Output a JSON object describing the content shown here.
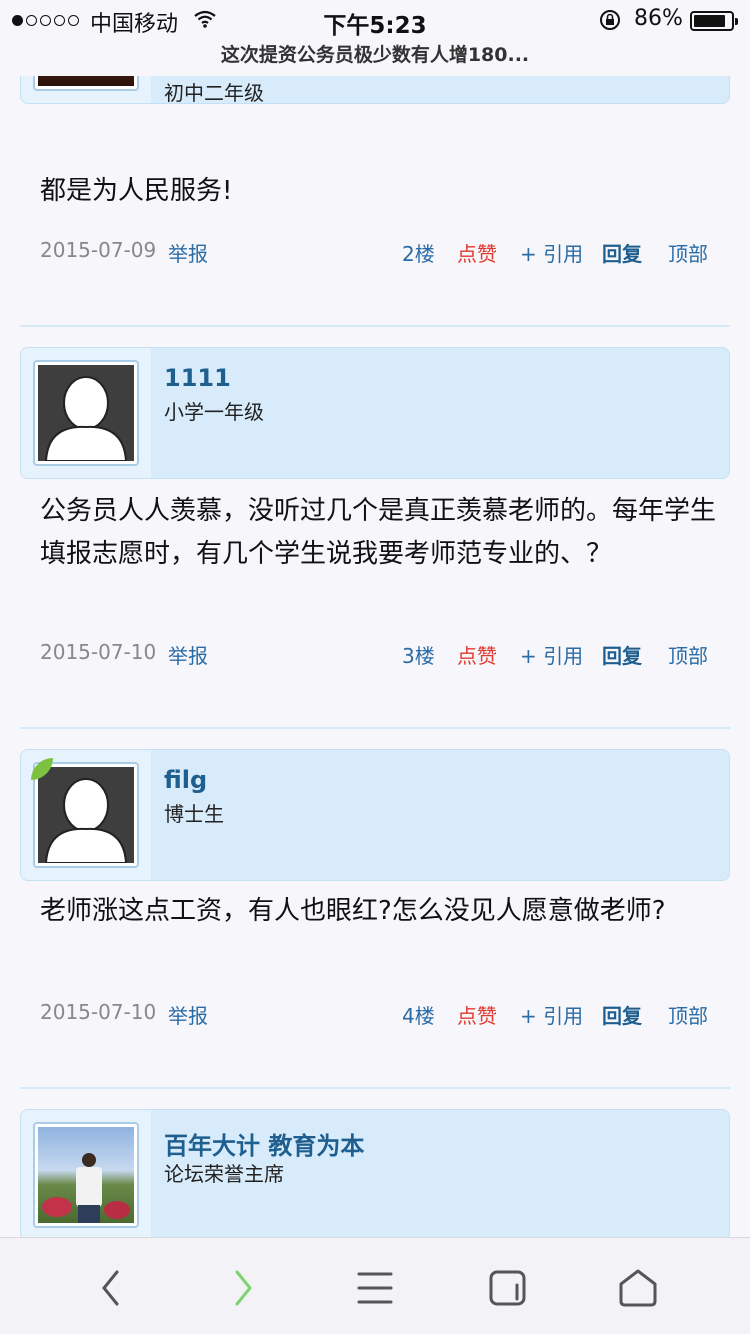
{
  "status_bar": {
    "carrier": "中国移动",
    "time": "下午5:23",
    "battery": "86%",
    "battery_level": 0.86,
    "signal_strength": 1
  },
  "page_title": "这次提资公务员极少数有人增180...",
  "posts": [
    {
      "user_name": "",
      "user_rank": "初中二年级",
      "avatar": "photo-avatar",
      "content": "都是为人民服务!",
      "date": "2015-07-09",
      "report": "举报",
      "floor": "2楼",
      "like": "点赞",
      "quote": "+ 引用",
      "reply": "回复",
      "top": "顶部"
    },
    {
      "user_name": "1111",
      "user_rank": "小学一年级",
      "avatar": "default-avatar",
      "content": "公务员人人羡慕，没听过几个是真正羡慕老师的。每年学生填报志愿时，有几个学生说我要考师范专业的、？",
      "date": "2015-07-10",
      "report": "举报",
      "floor": "3楼",
      "like": "点赞",
      "quote": "+ 引用",
      "reply": "回复",
      "top": "顶部"
    },
    {
      "user_name": "filg",
      "user_rank": "博士生",
      "avatar": "default-avatar",
      "content": "老师涨这点工资，有人也眼红?怎么没见人愿意做老师?",
      "date": "2015-07-10",
      "report": "举报",
      "floor": "4楼",
      "like": "点赞",
      "quote": "+ 引用",
      "reply": "回复",
      "top": "顶部"
    },
    {
      "user_name": "百年大计 教育为本",
      "user_rank": "论坛荣誉主席",
      "avatar": "photo-avatar"
    }
  ],
  "toolbar": {
    "icons": [
      "back-icon",
      "forward-icon",
      "menu-icon",
      "tabs-icon",
      "home-icon"
    ]
  },
  "colors": {
    "card_bg": "#d8ebfa",
    "username": "#1f5f8f",
    "link": "#2b6ca6",
    "like": "#e03a2e",
    "date": "#888888",
    "forward_enabled": "#7ed36f"
  }
}
